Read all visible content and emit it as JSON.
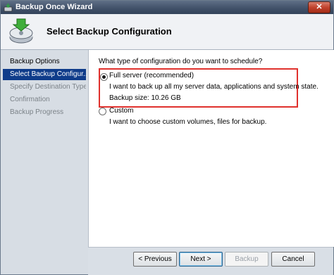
{
  "window": {
    "title": "Backup Once Wizard",
    "close_glyph": "✕"
  },
  "header": {
    "title": "Select Backup Configuration",
    "icon": "backup-drive-icon"
  },
  "sidebar": {
    "items": [
      {
        "label": "Backup Options",
        "state": "done"
      },
      {
        "label": "Select Backup Configur...",
        "state": "active"
      },
      {
        "label": "Specify Destination Type",
        "state": "pending"
      },
      {
        "label": "Confirmation",
        "state": "pending"
      },
      {
        "label": "Backup Progress",
        "state": "pending"
      }
    ]
  },
  "main": {
    "question": "What type of configuration do you want to schedule?",
    "options": [
      {
        "label": "Full server (recommended)",
        "description": "I want to back up all my server data, applications and system state.",
        "detail": "Backup size: 10.26 GB",
        "selected": true
      },
      {
        "label": "Custom",
        "description": "I want to choose custom volumes, files for backup.",
        "selected": false
      }
    ],
    "highlight_color": "#e0312d"
  },
  "footer": {
    "previous_label": "< Previous",
    "next_label": "Next >",
    "backup_label": "Backup",
    "cancel_label": "Cancel"
  },
  "colors": {
    "title_bar": "#42526a",
    "selection": "#0f3c8a",
    "sidebar": "#d7dde4"
  }
}
